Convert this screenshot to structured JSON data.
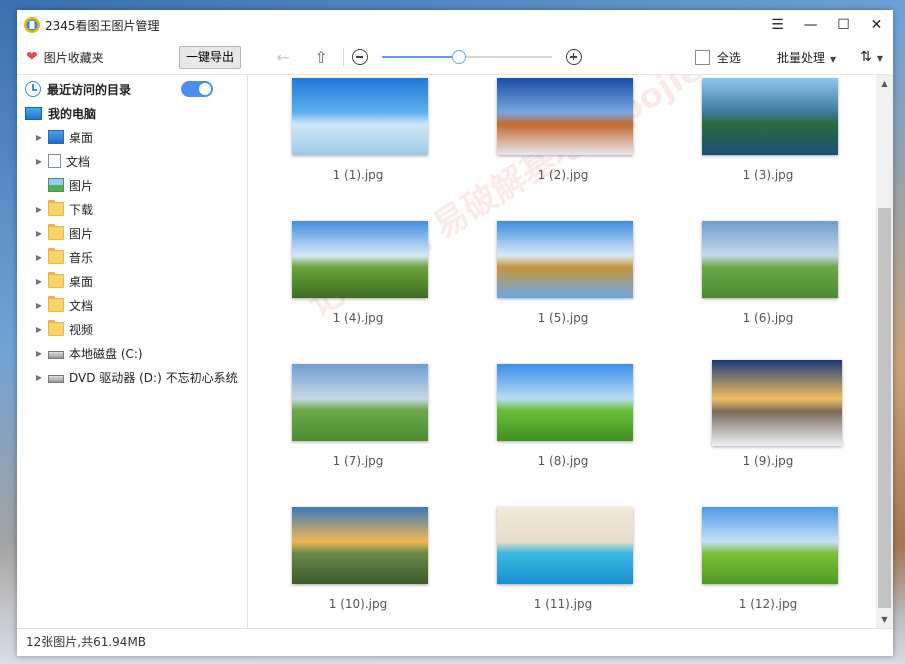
{
  "app": {
    "title": "2345看图王图片管理",
    "window_controls": {
      "menu": "☰",
      "minimize": "—",
      "maximize": "☐",
      "close": "✕"
    }
  },
  "toolbar": {
    "favorites_label": "图片收藏夹",
    "export_label": "一键导出",
    "zoom_level": 0.45,
    "select_all_label": "全选",
    "batch_label": "批量处理",
    "sort_icon": "sort-icon"
  },
  "sidebar": {
    "recent_label": "最近访问的目录",
    "recent_toggle_on": true,
    "computer_label": "我的电脑",
    "items": [
      {
        "label": "桌面",
        "icon": "desktop",
        "expandable": true
      },
      {
        "label": "文档",
        "icon": "doc",
        "expandable": true
      },
      {
        "label": "图片",
        "icon": "pic",
        "expandable": false
      },
      {
        "label": "下载",
        "icon": "folder",
        "expandable": true
      },
      {
        "label": "图片",
        "icon": "folder",
        "expandable": true
      },
      {
        "label": "音乐",
        "icon": "folder",
        "expandable": true
      },
      {
        "label": "桌面",
        "icon": "folder",
        "expandable": true
      },
      {
        "label": "文档",
        "icon": "folder",
        "expandable": true
      },
      {
        "label": "视频",
        "icon": "folder",
        "expandable": true
      },
      {
        "label": "本地磁盘 (C:)",
        "icon": "disk",
        "expandable": true
      },
      {
        "label": "DVD 驱动器 (D:) 不忘初心系统",
        "icon": "disk",
        "expandable": true
      }
    ]
  },
  "gallery": {
    "images": [
      {
        "name": "1 (1).jpg",
        "colors": [
          "#1f78d6",
          "#5fb0ee",
          "#cfe8f8",
          "#9ec9e8"
        ]
      },
      {
        "name": "1 (2).jpg",
        "colors": [
          "#1a4ea8",
          "#78a8e0",
          "#c46a2e",
          "#e8e8f0"
        ]
      },
      {
        "name": "1 (3).jpg",
        "colors": [
          "#8ec8f0",
          "#3a7a9a",
          "#2b6a3a",
          "#1c4f7a"
        ]
      },
      {
        "name": "1 (4).jpg",
        "colors": [
          "#3f8fe0",
          "#d8e8f8",
          "#6aa43a",
          "#3d6d22"
        ]
      },
      {
        "name": "1 (5).jpg",
        "colors": [
          "#3a8ee0",
          "#d9e9f7",
          "#c8953a",
          "#6aa8e8"
        ]
      },
      {
        "name": "1 (6).jpg",
        "colors": [
          "#6e9ed0",
          "#c8d8e8",
          "#6aa84a",
          "#4d8a32"
        ]
      },
      {
        "name": "1 (7).jpg",
        "colors": [
          "#6e9ed0",
          "#c8d8e8",
          "#6aa84a",
          "#4d8a32"
        ]
      },
      {
        "name": "1 (8).jpg",
        "colors": [
          "#3a8ee8",
          "#b8dcf5",
          "#6cbf3a",
          "#3f8f22"
        ]
      },
      {
        "name": "1 (9).jpg",
        "colors": [
          "#1a3a78",
          "#f2c060",
          "#7a6a5a",
          "#eef2f8"
        ]
      },
      {
        "name": "1 (10).jpg",
        "colors": [
          "#3a7ac0",
          "#f0b850",
          "#6a8a4a",
          "#3a5a2a"
        ]
      },
      {
        "name": "1 (11).jpg",
        "colors": [
          "#f4eadc",
          "#e8dcc8",
          "#39b8e0",
          "#1a8fd0"
        ]
      },
      {
        "name": "1 (12).jpg",
        "colors": [
          "#4a9ae8",
          "#c8e0f5",
          "#7ac23a",
          "#4f9a22"
        ]
      }
    ]
  },
  "watermark": "记得收藏 易破解基地 yipojie.com",
  "status": {
    "summary": "12张图片,共61.94MB"
  }
}
